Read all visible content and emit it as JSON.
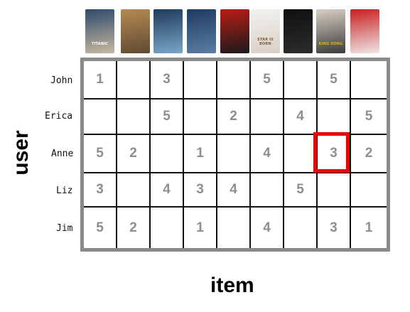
{
  "items": [
    {
      "title": "TITANIC",
      "colors": [
        "#2e4a6a",
        "#c7b8a0"
      ]
    },
    {
      "title": "",
      "colors": [
        "#b58a52",
        "#5f4a32"
      ]
    },
    {
      "title": "",
      "colors": [
        "#203a5a",
        "#78a7c9"
      ]
    },
    {
      "title": "",
      "colors": [
        "#1d3b63",
        "#5d7da4"
      ]
    },
    {
      "title": "",
      "colors": [
        "#b91d16",
        "#1a1a1a"
      ]
    },
    {
      "title": "STAR IS BORN",
      "colors": [
        "#f2f2f0",
        "#d9cfc5"
      ]
    },
    {
      "title": "",
      "colors": [
        "#101010",
        "#2c2c2c"
      ]
    },
    {
      "title": "KING KONG",
      "colors": [
        "#d8d0c4",
        "#3b3b3b"
      ]
    },
    {
      "title": "",
      "colors": [
        "#c81e1e",
        "#f0e6e6"
      ]
    }
  ],
  "users": [
    "John",
    "Erica",
    "Anne",
    "Liz",
    "Jim"
  ],
  "ratings": [
    [
      "1",
      "",
      "3",
      "",
      "",
      "5",
      "",
      "5",
      ""
    ],
    [
      "",
      "",
      "5",
      "",
      "2",
      "",
      "4",
      "",
      "5"
    ],
    [
      "5",
      "2",
      "",
      "1",
      "",
      "4",
      "",
      "3",
      "2"
    ],
    [
      "3",
      "",
      "4",
      "3",
      "4",
      "",
      "5",
      "",
      ""
    ],
    [
      "5",
      "2",
      "",
      "1",
      "",
      "4",
      "",
      "3",
      "1"
    ]
  ],
  "highlighted_cell": {
    "user": "Anne",
    "item_index": 7,
    "color": "#f00000"
  },
  "axes": {
    "y_label": "user",
    "x_label": "item"
  },
  "colors": {
    "grid_border": "#8a8a8a",
    "grid_lines": "#111111",
    "rating_text": "#8e8e8e"
  }
}
